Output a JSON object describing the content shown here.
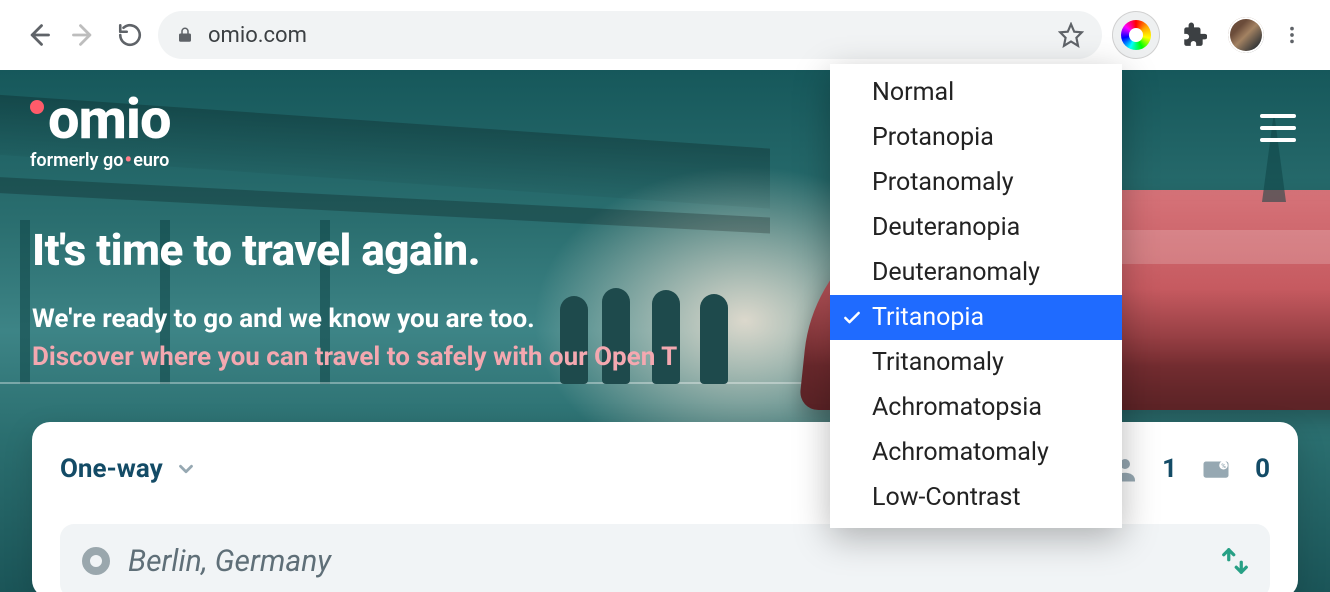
{
  "browser": {
    "url_display": "omio.com"
  },
  "logo": {
    "main": "omio",
    "sub_prefix": "formerly go",
    "sub_suffix": "euro"
  },
  "hero": {
    "headline": "It's time to travel again.",
    "subline": "We're ready to go and we know you are too.",
    "linkline": "Discover where you can travel to safely with our Open T"
  },
  "search": {
    "trip_type": "One-way",
    "passenger_count": "1",
    "bag_count": "0",
    "from_value": "Berlin, Germany"
  },
  "ext_menu": {
    "items": [
      {
        "label": "Normal",
        "selected": false
      },
      {
        "label": "Protanopia",
        "selected": false
      },
      {
        "label": "Protanomaly",
        "selected": false
      },
      {
        "label": "Deuteranopia",
        "selected": false
      },
      {
        "label": "Deuteranomaly",
        "selected": false
      },
      {
        "label": "Tritanopia",
        "selected": true
      },
      {
        "label": "Tritanomaly",
        "selected": false
      },
      {
        "label": "Achromatopsia",
        "selected": false
      },
      {
        "label": "Achromatomaly",
        "selected": false
      },
      {
        "label": "Low-Contrast",
        "selected": false
      }
    ]
  }
}
